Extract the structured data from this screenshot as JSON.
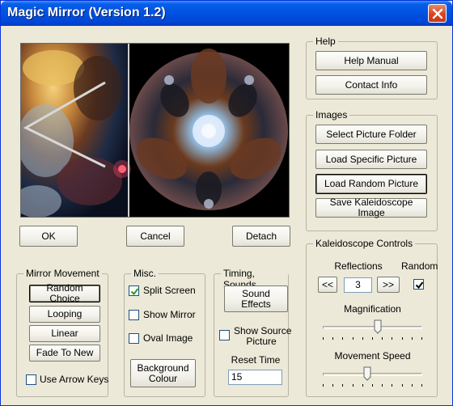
{
  "window": {
    "title": "Magic Mirror (Version 1.2)"
  },
  "main_buttons": {
    "ok": "OK",
    "cancel": "Cancel",
    "detach": "Detach"
  },
  "help": {
    "label": "Help",
    "manual": "Help Manual",
    "contact": "Contact Info"
  },
  "images": {
    "label": "Images",
    "select_folder": "Select Picture Folder",
    "load_specific": "Load Specific Picture",
    "load_random": "Load Random Picture",
    "save_kaleidoscope": "Save Kaleidoscope Image"
  },
  "mirror_movement": {
    "label": "Mirror Movement",
    "random_choice": "Random Choice",
    "looping": "Looping",
    "linear": "Linear",
    "fade_to_new": "Fade To New",
    "use_arrow_keys": "Use Arrow Keys",
    "use_arrow_keys_checked": false
  },
  "misc": {
    "label": "Misc.",
    "split_screen": "Split Screen",
    "split_screen_checked": true,
    "show_mirror": "Show Mirror",
    "show_mirror_checked": false,
    "oval_image": "Oval Image",
    "oval_image_checked": false,
    "background_colour_line1": "Background",
    "background_colour_line2": "Colour"
  },
  "timing": {
    "label": "Timing, Sounds",
    "sound_effects": "Sound Effects",
    "show_source_line1": "Show Source",
    "show_source_line2": "Picture",
    "show_source_checked": false,
    "reset_time_label": "Reset Time",
    "reset_time_value": "15"
  },
  "kaleidoscope": {
    "label": "Kaleidoscope Controls",
    "reflections_label": "Reflections",
    "random_label": "Random",
    "random_checked": true,
    "prev": "<<",
    "next": ">>",
    "reflections_value": "3",
    "magnification_label": "Magnification",
    "magnification_level": 0.55,
    "movement_speed_label": "Movement Speed",
    "movement_speed_level": 0.45
  },
  "colors": {
    "title_bar": "#0054e3",
    "face": "#ece9d8"
  }
}
